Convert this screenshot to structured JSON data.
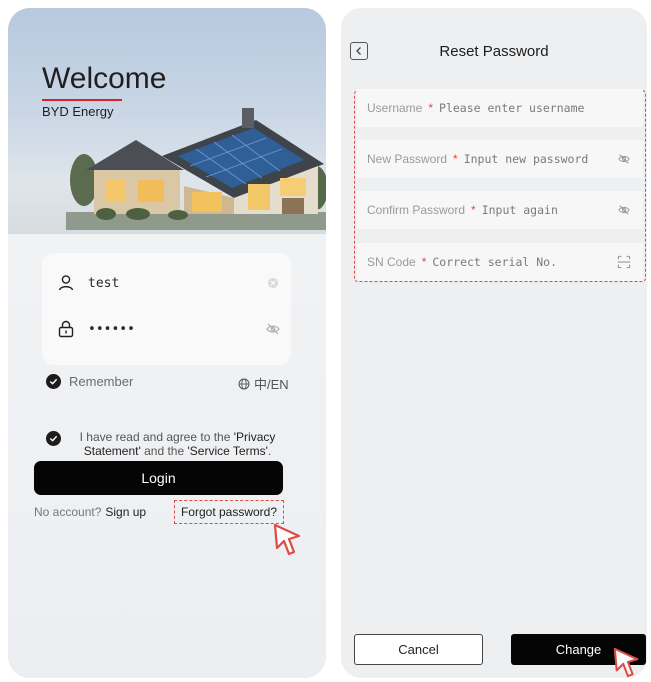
{
  "login": {
    "title": "Welcome",
    "brand": "BYD Energy",
    "username_value": "test",
    "password_value": "••••••",
    "remember_label": "Remember",
    "language_label": "中/EN",
    "agreement_prefix": "I have read and agree to the ",
    "privacy_label": "'Privacy Statement'",
    "agreement_mid": " and the ",
    "terms_label": "'Service Terms'",
    "agreement_suffix": ".",
    "login_button": "Login",
    "no_account_text": "No account?",
    "signup_link": "Sign up",
    "forgot_link": "Forgot password?"
  },
  "reset": {
    "title": "Reset Password",
    "fields": [
      {
        "label": "Username",
        "placeholder": "Please enter username",
        "icon": ""
      },
      {
        "label": "New Password",
        "placeholder": "Input new password",
        "icon": "eye-off-icon"
      },
      {
        "label": "Confirm Password",
        "placeholder": "Input again",
        "icon": "eye-off-icon"
      },
      {
        "label": "SN Code",
        "placeholder": "Correct serial No.",
        "icon": "scan-icon"
      }
    ],
    "required_mark": "*",
    "cancel_button": "Cancel",
    "change_button": "Change"
  },
  "colors": {
    "accent_red": "#d8232a",
    "highlight_dash": "#e04a44",
    "primary_button": "#050505"
  }
}
